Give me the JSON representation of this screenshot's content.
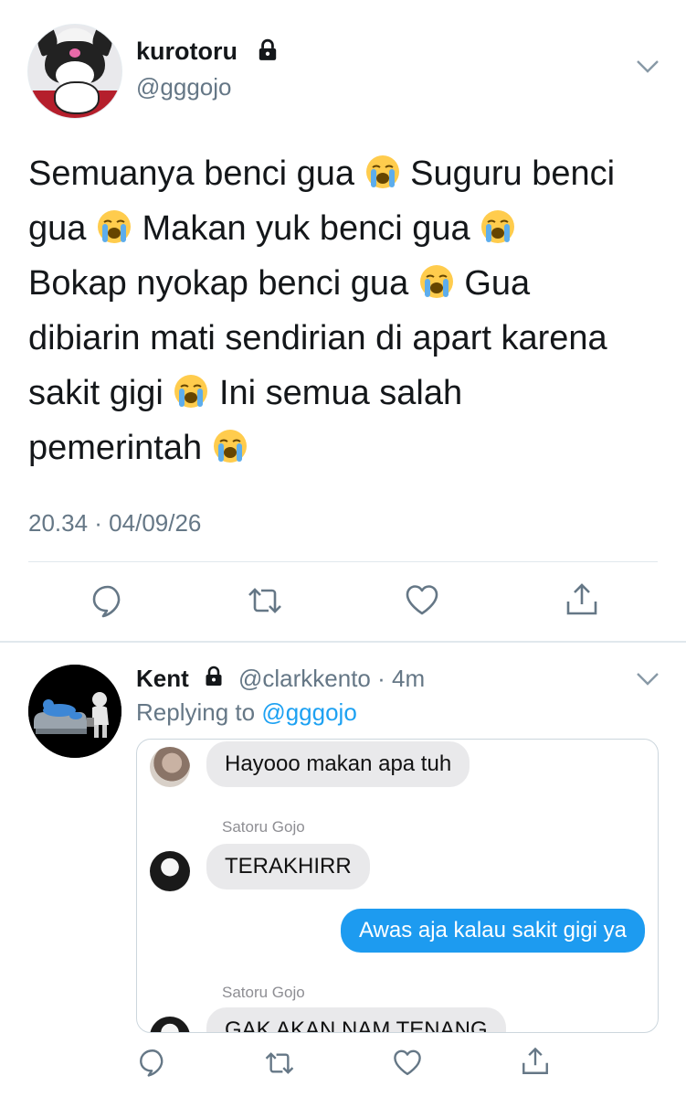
{
  "tweet": {
    "display_name": "kurotoru",
    "handle": "@gggojo",
    "text_lines": [
      [
        "Semuanya benci gua ",
        "😭",
        " Suguru benci"
      ],
      [
        "gua ",
        "😭",
        " Makan yuk benci gua ",
        "😭"
      ],
      [
        "Bokap nyokap benci gua ",
        "😭",
        " Gua"
      ],
      [
        "dibiarin mati sendirian di apart karena"
      ],
      [
        "sakit gigi ",
        "😭",
        " Ini semua salah"
      ],
      [
        "pemerintah ",
        "😭"
      ]
    ],
    "timestamp": "20.34 · 04/09/26",
    "actions": [
      "reply-icon",
      "retweet-icon",
      "like-icon",
      "share-icon"
    ]
  },
  "reply": {
    "display_name": "Kent",
    "handle_time": "@clarkkento · 4m",
    "replying_prefix": "Replying to ",
    "replying_handle": "@gggojo",
    "chat": {
      "msg1": "Hayooo makan apa tuh",
      "sender1": "Satoru Gojo",
      "msg2": "TERAKHIRR",
      "msg3": "Awas aja kalau sakit gigi ya",
      "sender2": "Satoru Gojo",
      "msg4": "GAK AKAN NAM TENANG"
    },
    "actions": [
      "reply-icon",
      "retweet-icon",
      "like-icon",
      "share-icon"
    ]
  },
  "colors": {
    "accent": "#1da1f2",
    "secondary_text": "#657786",
    "bubble_blue": "#1d9bf0",
    "bubble_gray": "#e9e9eb"
  }
}
